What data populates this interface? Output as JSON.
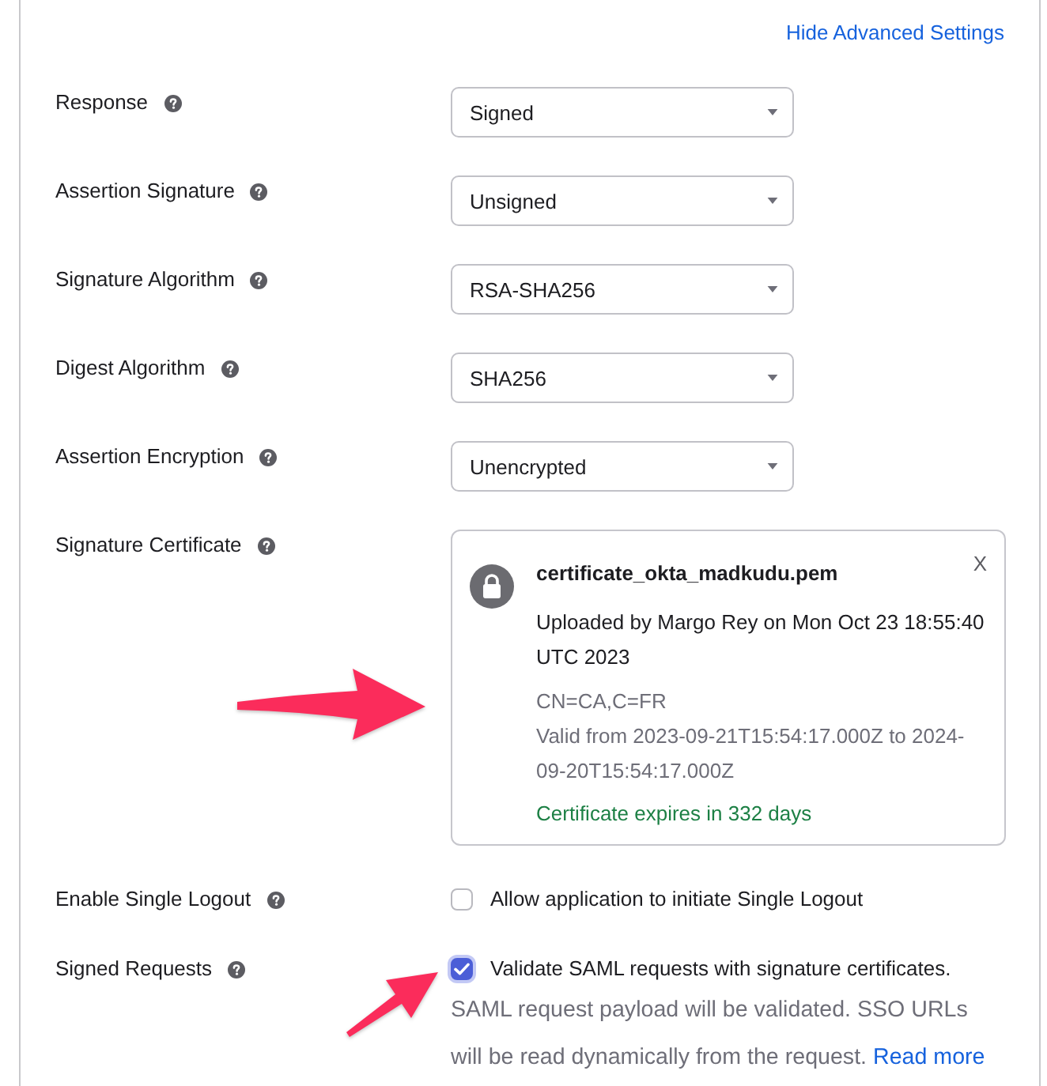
{
  "header_link": {
    "label": "Hide Advanced Settings"
  },
  "settings": [
    {
      "kind": "select",
      "label": "Response",
      "value": "Signed"
    },
    {
      "kind": "select",
      "label": "Assertion Signature",
      "value": "Unsigned"
    },
    {
      "kind": "select",
      "label": "Signature Algorithm",
      "value": "RSA-SHA256"
    },
    {
      "kind": "select",
      "label": "Digest Algorithm",
      "value": "SHA256"
    },
    {
      "kind": "select",
      "label": "Assertion Encryption",
      "value": "Unencrypted"
    },
    {
      "kind": "certificate",
      "label": "Signature Certificate",
      "certificate": {
        "filename": "certificate_okta_madkudu.pem",
        "close": "X",
        "uploaded": "Uploaded by Margo Rey on Mon Oct 23 18:55:40 UTC 2023",
        "subject": "CN=CA,C=FR",
        "validity": "Valid from 2023-09-21T15:54:17.000Z to 2024-09-20T15:54:17.000Z",
        "expiry": "Certificate expires in 332 days"
      }
    },
    {
      "kind": "checkbox",
      "label": "Enable Single Logout",
      "option": "Allow application to initiate Single Logout",
      "checked": false
    },
    {
      "kind": "checkbox",
      "label": "Signed Requests",
      "option": "Validate SAML requests with signature certificates.",
      "checked": true,
      "note": "SAML request payload will be validated. SSO URLs will be read dynamically from the request.",
      "link": "Read more"
    }
  ]
}
